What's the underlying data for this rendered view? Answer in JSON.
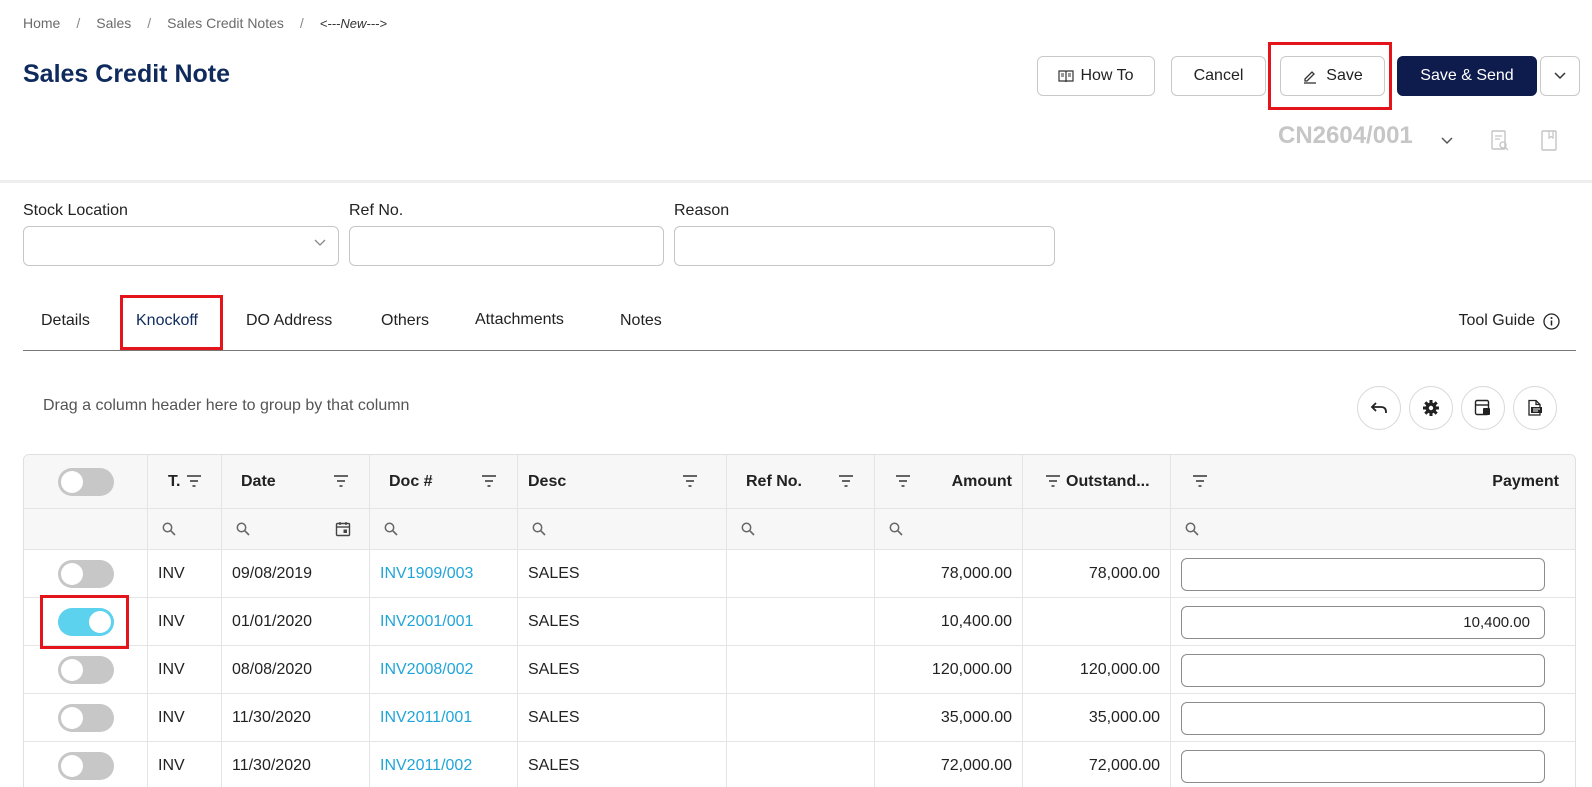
{
  "breadcrumb": [
    "Home",
    "Sales",
    "Sales Credit Notes",
    "<---New--->"
  ],
  "page_title": "Sales Credit Note",
  "actions": {
    "how_to": "How To",
    "cancel": "Cancel",
    "save": "Save",
    "save_send": "Save & Send"
  },
  "document_number": "CN2604/001",
  "fields": {
    "stock_location": {
      "label": "Stock Location",
      "value": ""
    },
    "ref_no": {
      "label": "Ref No.",
      "value": ""
    },
    "reason": {
      "label": "Reason",
      "value": ""
    }
  },
  "tabs": [
    "Details",
    "Knockoff",
    "DO Address",
    "Others",
    "Attachments",
    "Notes"
  ],
  "active_tab": "Knockoff",
  "tool_guide": "Tool Guide",
  "group_hint": "Drag a column header here to group by that column",
  "grid": {
    "select_all": false,
    "columns": [
      "T.",
      "Date",
      "Doc #",
      "Desc",
      "Ref No.",
      "Amount",
      "Outstand...",
      "Payment"
    ],
    "rows": [
      {
        "selected": false,
        "type": "INV",
        "date": "09/08/2019",
        "doc": "INV1909/003",
        "desc": "SALES",
        "ref": "",
        "amount": "78,000.00",
        "outstanding": "78,000.00",
        "payment": ""
      },
      {
        "selected": true,
        "type": "INV",
        "date": "01/01/2020",
        "doc": "INV2001/001",
        "desc": "SALES",
        "ref": "",
        "amount": "10,400.00",
        "outstanding": "",
        "payment": "10,400.00"
      },
      {
        "selected": false,
        "type": "INV",
        "date": "08/08/2020",
        "doc": "INV2008/002",
        "desc": "SALES",
        "ref": "",
        "amount": "120,000.00",
        "outstanding": "120,000.00",
        "payment": ""
      },
      {
        "selected": false,
        "type": "INV",
        "date": "11/30/2020",
        "doc": "INV2011/001",
        "desc": "SALES",
        "ref": "",
        "amount": "35,000.00",
        "outstanding": "35,000.00",
        "payment": ""
      },
      {
        "selected": false,
        "type": "INV",
        "date": "11/30/2020",
        "doc": "INV2011/002",
        "desc": "SALES",
        "ref": "",
        "amount": "72,000.00",
        "outstanding": "72,000.00",
        "payment": ""
      }
    ]
  },
  "colors": {
    "brand_navy": "#0d1b4d",
    "title_navy": "#0f2a5c",
    "link_blue": "#21a5d8",
    "toggle_on": "#5cd2ef",
    "highlight_red": "#e3141a"
  }
}
